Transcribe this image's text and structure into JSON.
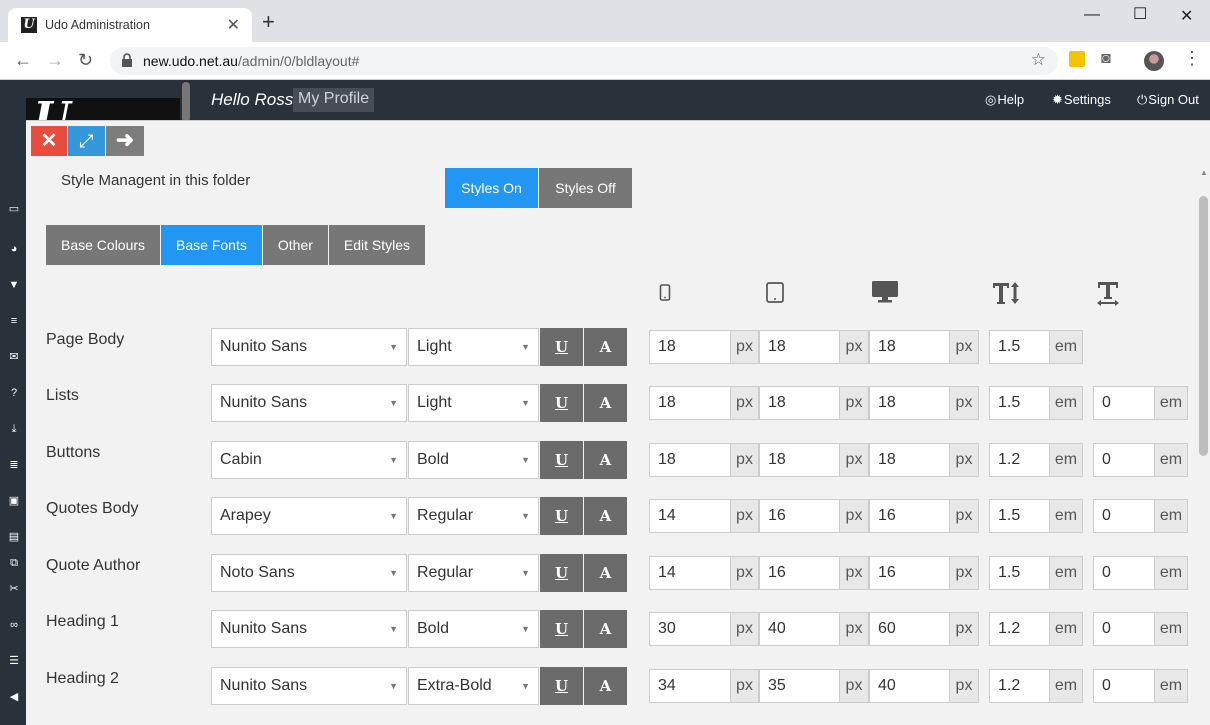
{
  "browser": {
    "tab_title": "Udo Administration",
    "url_host": "new.udo.net.au",
    "url_path": "/admin/0/bldlayout#"
  },
  "header": {
    "greeting": "Hello Ross",
    "profile_link": "My Profile",
    "help": "Help",
    "settings": "Settings",
    "sign_out": "Sign Out"
  },
  "panel": {
    "title": "Style Managent in this folder",
    "styles_on": "Styles On",
    "styles_off": "Styles Off",
    "tabs": [
      {
        "label": "Base Colours",
        "active": false
      },
      {
        "label": "Base Fonts",
        "active": true
      },
      {
        "label": "Other",
        "active": false
      },
      {
        "label": "Edit Styles",
        "active": false
      }
    ],
    "columns": [
      "mobile-icon",
      "tablet-icon",
      "desktop-icon",
      "line-height-icon",
      "letter-spacing-icon"
    ],
    "underline_btn": "U",
    "case_btn": "A",
    "unit_px": "px",
    "unit_em": "em"
  },
  "rows": [
    {
      "label": "Page Body",
      "font": "Nunito Sans",
      "weight": "Light",
      "mobile": "18",
      "tablet": "18",
      "desktop": "18",
      "line_height": "1.5",
      "spacing": ""
    },
    {
      "label": "Lists",
      "font": "Nunito Sans",
      "weight": "Light",
      "mobile": "18",
      "tablet": "18",
      "desktop": "18",
      "line_height": "1.5",
      "spacing": "0"
    },
    {
      "label": "Buttons",
      "font": "Cabin",
      "weight": "Bold",
      "mobile": "18",
      "tablet": "18",
      "desktop": "18",
      "line_height": "1.2",
      "spacing": "0"
    },
    {
      "label": "Quotes Body",
      "font": "Arapey",
      "weight": "Regular",
      "mobile": "14",
      "tablet": "16",
      "desktop": "16",
      "line_height": "1.5",
      "spacing": "0"
    },
    {
      "label": "Quote Author",
      "font": "Noto Sans",
      "weight": "Regular",
      "mobile": "14",
      "tablet": "16",
      "desktop": "16",
      "line_height": "1.5",
      "spacing": "0"
    },
    {
      "label": "Heading 1",
      "font": "Nunito Sans",
      "weight": "Bold",
      "mobile": "30",
      "tablet": "40",
      "desktop": "60",
      "line_height": "1.2",
      "spacing": "0"
    },
    {
      "label": "Heading 2",
      "font": "Nunito Sans",
      "weight": "Extra-Bold",
      "mobile": "34",
      "tablet": "35",
      "desktop": "40",
      "line_height": "1.2",
      "spacing": "0"
    }
  ],
  "colors": {
    "accent": "#2196f3",
    "header_bg": "#29313b",
    "close_red": "#e74c3c",
    "button_grey": "#777777"
  }
}
